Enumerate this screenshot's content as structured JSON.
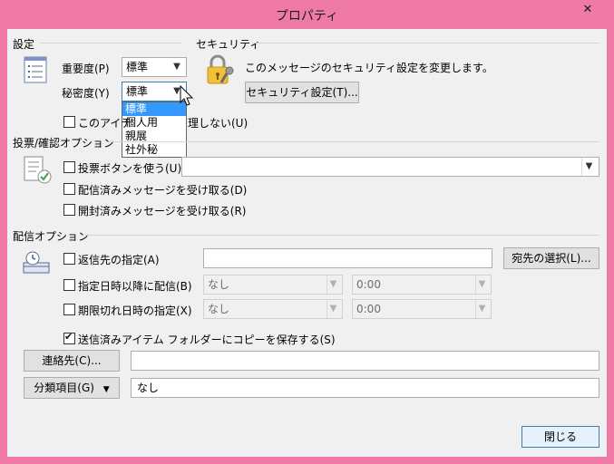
{
  "window": {
    "title": "プロパティ",
    "close_glyph": "✕"
  },
  "settings": {
    "section_label": "設定",
    "importance_label": "重要度(P)",
    "importance_value": "標準",
    "sensitivity_label": "秘密度(Y)",
    "sensitivity_value": "標準",
    "sensitivity_options": [
      "標準",
      "個人用",
      "親展",
      "社外秘"
    ],
    "autoarchive_label_prefix": "このアイテ",
    "autoarchive_label_suffix": "理しない(U)"
  },
  "security": {
    "section_label": "セキュリティ",
    "description": "このメッセージのセキュリティ設定を変更します。",
    "button_label": "セキュリティ設定(T)..."
  },
  "voting": {
    "section_label": "投票/確認オプション",
    "use_voting_label": "投票ボタンを使う(U)",
    "delivery_receipt_label": "配信済みメッセージを受け取る(D)",
    "read_receipt_label": "開封済みメッセージを受け取る(R)"
  },
  "delivery": {
    "section_label": "配信オプション",
    "reply_to_label": "返信先の指定(A)",
    "select_names_button": "宛先の選択(L)...",
    "deferred_label": "指定日時以降に配信(B)",
    "deferred_date": "なし",
    "deferred_time": "0:00",
    "expires_label": "期限切れ日時の指定(X)",
    "expires_date": "なし",
    "expires_time": "0:00",
    "save_sent_label": "送信済みアイテム フォルダーにコピーを保存する(S)",
    "save_sent_checked": true
  },
  "contacts": {
    "button_label": "連絡先(C)...",
    "value": ""
  },
  "categories": {
    "button_label": "分類項目(G)",
    "value": "なし"
  },
  "footer": {
    "close_button": "閉じる"
  }
}
